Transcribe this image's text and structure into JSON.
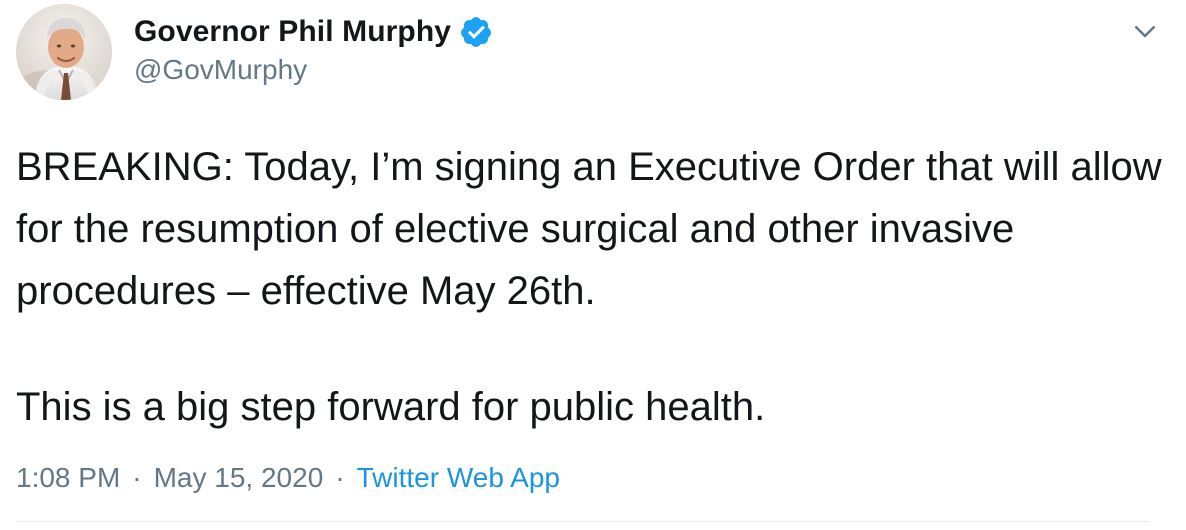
{
  "tweet": {
    "author": {
      "name": "Governor Phil Murphy",
      "handle": "@GovMurphy"
    },
    "body": {
      "paragraph_1": "BREAKING: Today, I’m signing an Executive Order that will allow for the resumption of elective surgical and other invasive procedures – effective May 26th.",
      "paragraph_2": "This is a big step forward for public health."
    },
    "meta": {
      "time": "1:08 PM",
      "separator_1": "·",
      "date": "May 15, 2020",
      "separator_2": "·",
      "source": "Twitter Web App"
    }
  },
  "colors": {
    "text": "#14171a",
    "secondary": "#657786",
    "link": "#1b95e0",
    "verified": "#1da1f2",
    "divider": "#e6ecf0"
  },
  "icons": {
    "verified": "verified-badge-icon",
    "menu": "chevron-down-icon"
  }
}
